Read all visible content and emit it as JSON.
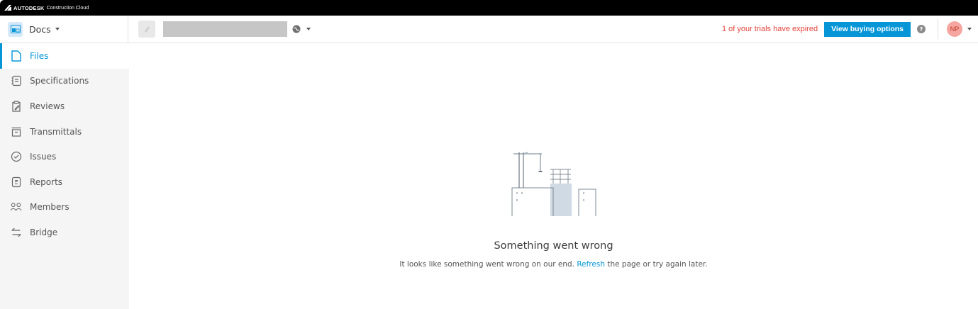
{
  "brand": {
    "name": "AUTODESK",
    "product": "Construction Cloud"
  },
  "header": {
    "app_name": "Docs",
    "trial_text": "1 of your trials have expired",
    "buy_label": "View buying options",
    "help_glyph": "?",
    "avatar_initials": "NP"
  },
  "sidebar": {
    "items": [
      {
        "label": "Files",
        "icon": "file-icon",
        "active": true
      },
      {
        "label": "Specifications",
        "icon": "specifications-icon"
      },
      {
        "label": "Reviews",
        "icon": "reviews-icon"
      },
      {
        "label": "Transmittals",
        "icon": "transmittals-icon"
      },
      {
        "label": "Issues",
        "icon": "issues-icon"
      },
      {
        "label": "Reports",
        "icon": "reports-icon"
      },
      {
        "label": "Members",
        "icon": "members-icon"
      },
      {
        "label": "Bridge",
        "icon": "bridge-icon"
      }
    ]
  },
  "error": {
    "title": "Something went wrong",
    "message_before": "It looks like something went wrong on our end. ",
    "link": "Refresh",
    "message_after": " the page or try again later."
  },
  "colors": {
    "accent": "#0696d7",
    "alert": "#e5433b",
    "sidebar_bg": "#f5f5f5"
  }
}
